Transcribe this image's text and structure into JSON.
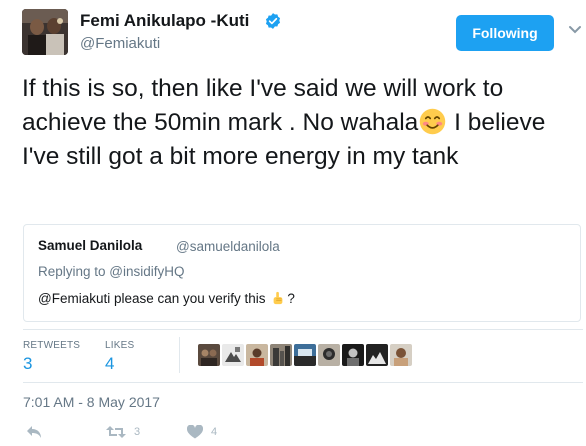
{
  "author": {
    "name": "Femi Anikulapo -Kuti",
    "handle": "@Femiakuti",
    "verified_icon": "verified-badge-icon"
  },
  "follow_button": {
    "label": "Following"
  },
  "tweet": {
    "text_before_emoji": "If this is so, then like I've said we will work to achieve the 50min mark . No wahala",
    "emoji": "smiling-face-emoji",
    "text_after_emoji": " I believe I've still got a bit more energy in my tank"
  },
  "quoted_tweet": {
    "name": "Samuel Danilola",
    "handle": "@samueldanilola",
    "replying_to": "Replying to @insidifyHQ",
    "text_before": "@Femiakuti please can you verify this",
    "text_after": "?",
    "emoji": "pointing-hand-emoji"
  },
  "stats": {
    "retweets_label": "RETWEETS",
    "retweets_count": "3",
    "likes_label": "LIKES",
    "likes_count": "4"
  },
  "timestamp": "7:01 AM - 8 May 2017",
  "actions": {
    "reply_icon": "reply-icon",
    "retweet_icon": "retweet-icon",
    "retweet_count": "3",
    "like_icon": "heart-icon",
    "like_count": "4"
  },
  "colors": {
    "accent": "#1da1f2",
    "link": "#1b95e0",
    "muted": "#657786",
    "border": "#e1e8ed"
  }
}
